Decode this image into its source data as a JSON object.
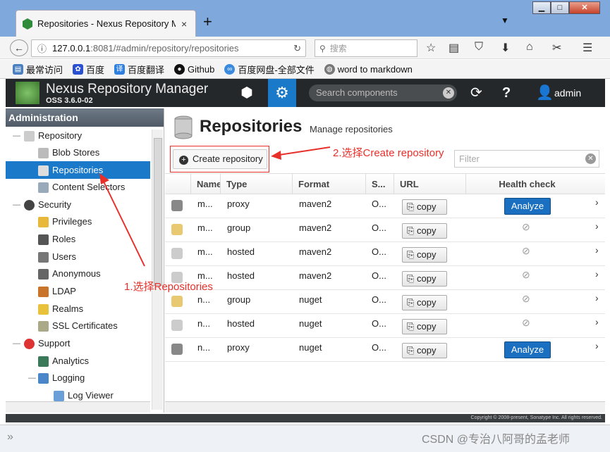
{
  "browser": {
    "tab_title": "Repositories - Nexus Repository M",
    "tab_close": "×",
    "new_tab": "+",
    "url_host": "127.0.0.1",
    "url_path": ":8081/#admin/repository/repositories",
    "search_placeholder": "搜索",
    "bookmarks": [
      "最常访问",
      "百度",
      "百度翻译",
      "Github",
      "百度网盘-全部文件",
      "word to markdown"
    ]
  },
  "app": {
    "title": "Nexus Repository Manager",
    "version": "OSS 3.6.0-02",
    "search_placeholder": "Search components",
    "user": "admin"
  },
  "sidebar": {
    "header": "Administration",
    "items": [
      {
        "label": "Repository",
        "icon": "database-icon"
      },
      {
        "label": "Blob Stores",
        "icon": "server-icon"
      },
      {
        "label": "Repositories",
        "icon": "database-icon"
      },
      {
        "label": "Content Selectors",
        "icon": "selector-icon"
      },
      {
        "label": "Security",
        "icon": "eye-icon"
      },
      {
        "label": "Privileges",
        "icon": "medal-icon"
      },
      {
        "label": "Roles",
        "icon": "user-role-icon"
      },
      {
        "label": "Users",
        "icon": "users-icon"
      },
      {
        "label": "Anonymous",
        "icon": "anonymous-icon"
      },
      {
        "label": "LDAP",
        "icon": "book-icon"
      },
      {
        "label": "Realms",
        "icon": "shield-icon"
      },
      {
        "label": "SSL Certificates",
        "icon": "certificate-icon"
      },
      {
        "label": "Support",
        "icon": "lifebuoy-icon"
      },
      {
        "label": "Analytics",
        "icon": "chart-icon"
      },
      {
        "label": "Logging",
        "icon": "document-icon"
      },
      {
        "label": "Log Viewer",
        "icon": "document-icon"
      }
    ]
  },
  "main": {
    "title": "Repositories",
    "subtitle": "Manage repositories",
    "create_button": "Create repository",
    "filter_placeholder": "Filter",
    "columns": [
      "Name",
      "Type",
      "Format",
      "S...",
      "URL",
      "Health check"
    ],
    "copy_label": "copy",
    "analyze_label": "Analyze",
    "rows": [
      {
        "name": "m...",
        "type": "proxy",
        "format": "maven2",
        "status": "O...",
        "health": "analyze"
      },
      {
        "name": "m...",
        "type": "group",
        "format": "maven2",
        "status": "O...",
        "health": "none"
      },
      {
        "name": "m...",
        "type": "hosted",
        "format": "maven2",
        "status": "O...",
        "health": "none"
      },
      {
        "name": "m...",
        "type": "hosted",
        "format": "maven2",
        "status": "O...",
        "health": "none"
      },
      {
        "name": "n...",
        "type": "group",
        "format": "nuget",
        "status": "O...",
        "health": "none"
      },
      {
        "name": "n...",
        "type": "hosted",
        "format": "nuget",
        "status": "O...",
        "health": "none"
      },
      {
        "name": "n...",
        "type": "proxy",
        "format": "nuget",
        "status": "O...",
        "health": "analyze"
      }
    ]
  },
  "footer": "Copyright © 2008-present, Sonatype Inc. All rights reserved.",
  "annotations": {
    "step1": "1.选择Repositories",
    "step2": "2.选择Create repository"
  },
  "watermark": "CSDN @专治八阿哥的孟老师",
  "colors": {
    "accent": "#1a7ac9",
    "annotation": "#e8302a",
    "header_bg": "#25282b"
  }
}
